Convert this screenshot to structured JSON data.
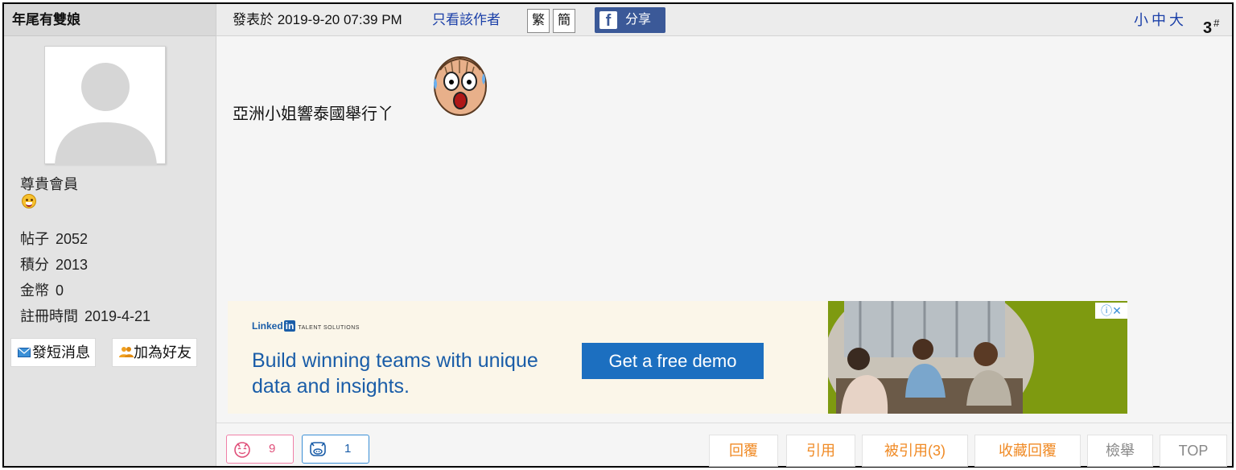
{
  "author": {
    "name": "年尾有雙娘",
    "rank": "尊貴會員",
    "stats": [
      {
        "label": "帖子",
        "value": "2052"
      },
      {
        "label": "積分",
        "value": "2013"
      },
      {
        "label": "金幣",
        "value": "0"
      },
      {
        "label": "註冊時間",
        "value": "2019-4-21"
      }
    ],
    "send_message": "發短消息",
    "add_friend": "加為好友"
  },
  "post": {
    "posted_at": "發表於 2019-9-20 07:39 PM",
    "only_author": "只看該作者",
    "traditional": "繁",
    "simplified": "簡",
    "share": "分享",
    "font_sizes": "小中大",
    "floor_number": "3",
    "floor_mark": "#",
    "content": "亞洲小姐響泰國舉行丫"
  },
  "ad": {
    "brand": "Linked",
    "brand_in": "in",
    "brand_sub": "TALENT SOLUTIONS",
    "headline": "Build winning teams with unique data and insights.",
    "cta": "Get a free demo",
    "info": "ⓘ✕"
  },
  "reactions": [
    {
      "name": "love",
      "count": "9"
    },
    {
      "name": "pig",
      "count": "1"
    }
  ],
  "actions": {
    "reply": "回覆",
    "quote": "引用",
    "quoted": "被引用(3)",
    "favorite": "收藏回覆",
    "report": "檢舉",
    "top": "TOP"
  },
  "colors": {
    "link_blue": "#1a3fa8",
    "action_orange": "#f08a24",
    "facebook": "#3b5998",
    "ad_blue": "#1c6fc0"
  }
}
